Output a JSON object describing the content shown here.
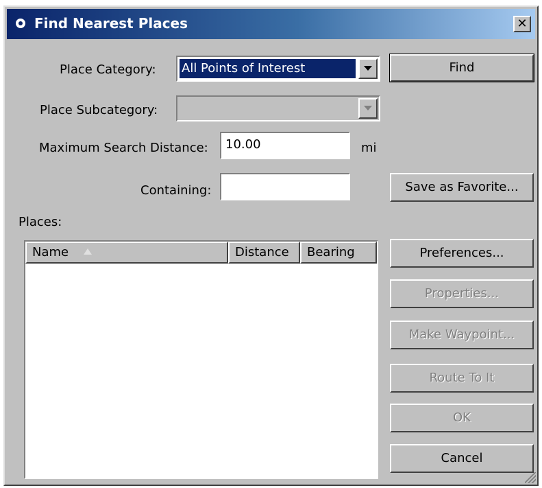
{
  "window": {
    "title": "Find Nearest Places",
    "close_label": "✕"
  },
  "form": {
    "category_label": "Place Category:",
    "category_value": "All Points of Interest",
    "subcategory_label": "Place Subcategory:",
    "subcategory_value": "",
    "distance_label": "Maximum Search Distance:",
    "distance_value": "10.00",
    "distance_unit": "mi",
    "containing_label": "Containing:",
    "containing_value": ""
  },
  "places": {
    "label": "Places:",
    "columns": [
      "Name",
      "Distance",
      "Bearing"
    ],
    "sort_column": "Name",
    "rows": []
  },
  "buttons": {
    "find": "Find",
    "save_favorite": "Save as Favorite...",
    "preferences": "Preferences...",
    "properties": "Properties...",
    "make_waypoint": "Make Waypoint...",
    "route_to_it": "Route To It",
    "ok": "OK",
    "cancel": "Cancel"
  },
  "icons": {
    "title": "app-icon",
    "sort": "sort-ascending-icon",
    "dropdown": "dropdown-arrow-icon",
    "close": "close-icon",
    "grip": "resize-grip-icon"
  },
  "colors": {
    "title_start": "#0a246a",
    "title_end": "#a6caf0",
    "face": "#c0c0c0",
    "selection": "#0a246a"
  }
}
